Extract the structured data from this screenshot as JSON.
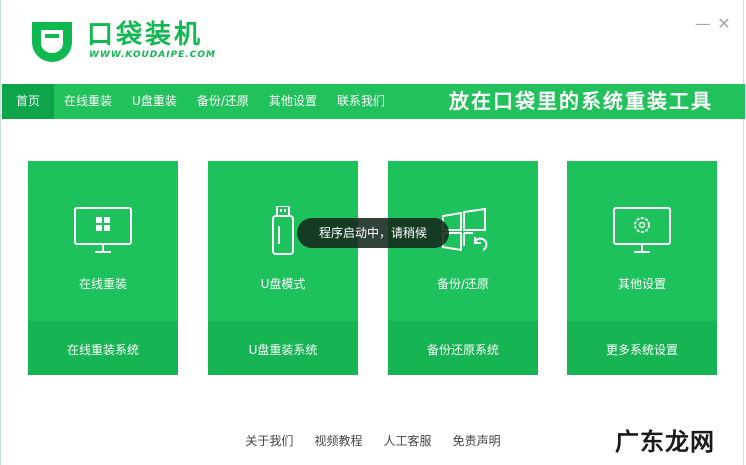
{
  "header": {
    "title": "口袋装机",
    "subtitle": "WWW.KOUDAIPE.COM",
    "minimize_label": "—",
    "close_label": "✕"
  },
  "nav": {
    "items": [
      {
        "label": "首页",
        "active": true
      },
      {
        "label": "在线重装"
      },
      {
        "label": "U盘重装"
      },
      {
        "label": "备份/还原"
      },
      {
        "label": "其他设置"
      },
      {
        "label": "联系我们"
      }
    ],
    "slogan": "放在口袋里的系统重装工具"
  },
  "cards": [
    {
      "icon": "monitor-windows-icon",
      "title": "在线重装",
      "footer": "在线重装系统"
    },
    {
      "icon": "usb-drive-icon",
      "title": "U盘模式",
      "footer": "U盘重装系统"
    },
    {
      "icon": "windows-restore-icon",
      "title": "备份/还原",
      "footer": "备份还原系统"
    },
    {
      "icon": "monitor-gear-icon",
      "title": "其他设置",
      "footer": "更多系统设置"
    }
  ],
  "toast": "程序启动中，请稍候",
  "footer": {
    "links": [
      "关于我们",
      "视频教程",
      "人工客服",
      "免责声明"
    ]
  },
  "watermark": "广东龙网",
  "colors": {
    "brand": "#1dc25c",
    "nav": "#21c15b",
    "nav_active": "#0ea44a",
    "card_footer": "#16b452"
  }
}
